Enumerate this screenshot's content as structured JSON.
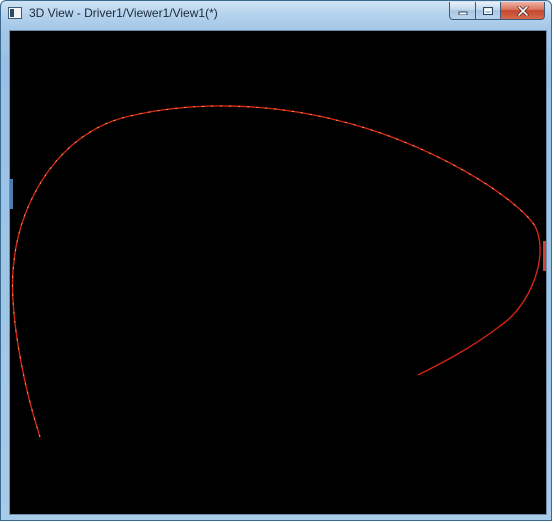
{
  "window": {
    "title": "3D View - Driver1/Viewer1/View1(*)",
    "icon": "window-app-icon"
  },
  "controls": {
    "minimize": "minimize-icon",
    "maximize": "maximize-icon",
    "close": "close-icon"
  },
  "viewport": {
    "background_color": "#000000",
    "curve": {
      "color": "#d32414",
      "highlight_color": "#ffd070"
    }
  },
  "colors": {
    "titlebar": "#a6c9e8",
    "close_button": "#c4472e"
  }
}
